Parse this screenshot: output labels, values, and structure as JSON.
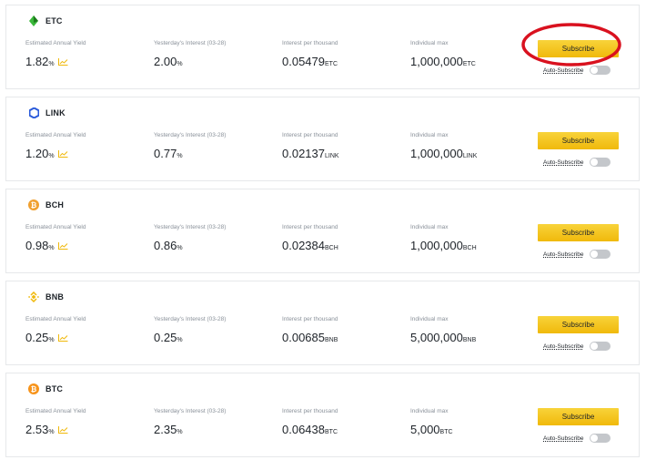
{
  "labels": {
    "yield": "Estimated Annual Yield",
    "yesterday": "Yesterday's Interest (03-28)",
    "per_thousand": "Interest per thousand",
    "max": "Individual max",
    "subscribe": "Subscribe",
    "auto_subscribe": "Auto-Subscribe"
  },
  "colors": {
    "accent": "#f0b90b",
    "annotation": "#d9111f"
  },
  "products": [
    {
      "coin": "ETC",
      "icon": "etc-icon",
      "icon_color": "#3ab83a",
      "yield": "1.82",
      "yield_unit": "%",
      "yesterday": "2.00",
      "yesterday_unit": "%",
      "per_thousand": "0.05479",
      "per_thousand_unit": "ETC",
      "max": "1,000,000",
      "max_unit": "ETC",
      "auto_subscribe_on": false
    },
    {
      "coin": "LINK",
      "icon": "link-icon",
      "icon_color": "#2a5ada",
      "yield": "1.20",
      "yield_unit": "%",
      "yesterday": "0.77",
      "yesterday_unit": "%",
      "per_thousand": "0.02137",
      "per_thousand_unit": "LINK",
      "max": "1,000,000",
      "max_unit": "LINK",
      "auto_subscribe_on": false
    },
    {
      "coin": "BCH",
      "icon": "bch-icon",
      "icon_color": "#f0a030",
      "yield": "0.98",
      "yield_unit": "%",
      "yesterday": "0.86",
      "yesterday_unit": "%",
      "per_thousand": "0.02384",
      "per_thousand_unit": "BCH",
      "max": "1,000,000",
      "max_unit": "BCH",
      "auto_subscribe_on": false
    },
    {
      "coin": "BNB",
      "icon": "bnb-icon",
      "icon_color": "#f0b90b",
      "yield": "0.25",
      "yield_unit": "%",
      "yesterday": "0.25",
      "yesterday_unit": "%",
      "per_thousand": "0.00685",
      "per_thousand_unit": "BNB",
      "max": "5,000,000",
      "max_unit": "BNB",
      "auto_subscribe_on": false
    },
    {
      "coin": "BTC",
      "icon": "btc-icon",
      "icon_color": "#f7931a",
      "yield": "2.53",
      "yield_unit": "%",
      "yesterday": "2.35",
      "yesterday_unit": "%",
      "per_thousand": "0.06438",
      "per_thousand_unit": "BTC",
      "max": "5,000",
      "max_unit": "BTC",
      "auto_subscribe_on": false
    }
  ]
}
